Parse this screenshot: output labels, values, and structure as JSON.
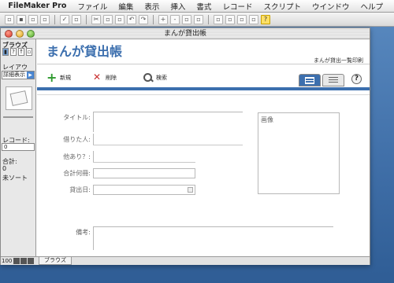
{
  "menubar": {
    "app_name": "FileMaker Pro",
    "items": [
      "ファイル",
      "編集",
      "表示",
      "挿入",
      "書式",
      "レコード",
      "スクリプト",
      "ウインドウ",
      "ヘルプ"
    ]
  },
  "window": {
    "title": "まんが貸出帳"
  },
  "status_area": {
    "mode": "ブラウズ",
    "layout_label": "レイアウト:",
    "layout_value": "詳細表示",
    "record_label": "レコード:",
    "record_value": "0",
    "total_label": "合計:",
    "total_value": "0",
    "sort_state": "未ソート"
  },
  "content": {
    "title": "まんが貸出帳",
    "report_link": "まんが貸出一覧印刷",
    "actions": {
      "new": "新規",
      "delete": "削除",
      "find": "検索"
    },
    "help_symbol": "?",
    "fields": {
      "title": "タイトル:",
      "borrower": "借りた人:",
      "others": "他あり？:",
      "total_count": "合計何冊:",
      "lend_date": "貸出日:",
      "notes": "備考:",
      "image": "画像"
    }
  },
  "bottom_bar": {
    "zoom": "100",
    "mode": "ブラウズ"
  },
  "colors": {
    "accent": "#3c6fae",
    "desktop": "#4f7fb4"
  }
}
